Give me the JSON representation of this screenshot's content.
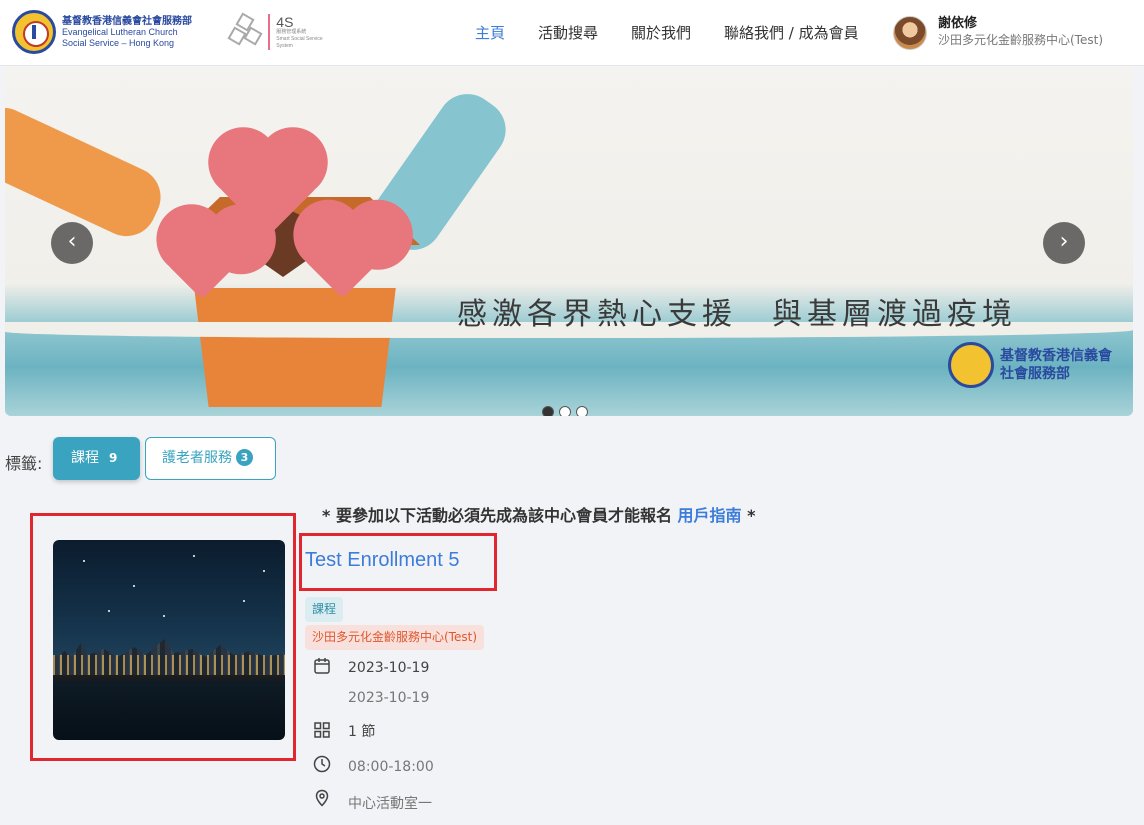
{
  "header": {
    "logo_org": {
      "zh": "基督教香港信義會社會服務部",
      "en1": "Evangelical Lutheran Church",
      "en2": "Social Service – Hong Kong"
    },
    "logo_4s": {
      "title": "4S",
      "sub1": "服務管理系統",
      "sub2": "Smart Social Service System"
    },
    "nav": [
      "主頁",
      "活動搜尋",
      "關於我們",
      "聯絡我們 / 成為會員"
    ],
    "active_nav": "主頁",
    "user": {
      "name": "謝依修",
      "center": "沙田多元化金齡服務中心(Test)"
    }
  },
  "banner": {
    "text": "感激各界熱心支援　與基層渡過疫境",
    "logo_line1": "基督教香港信義會",
    "logo_line2": "社會服務部",
    "prev_icon": "‹",
    "next_icon": "›",
    "slides": 3,
    "current_slide": 1
  },
  "tags": {
    "label": "標籤:",
    "items": [
      {
        "name": "課程",
        "count": "9",
        "active": true
      },
      {
        "name": "護老者服務",
        "count": "3",
        "active": false
      }
    ]
  },
  "notice": {
    "prefix": "* 要參加以下活動必須先成為該中心會員才能報名",
    "link": "用戶指南",
    "suffix": "*"
  },
  "activity": {
    "title": "Test Enrollment 5",
    "category": "課程",
    "center": "沙田多元化金齡服務中心(Test)",
    "start_date": "2023-10-19",
    "end_date": "2023-10-19",
    "sessions": "1 節",
    "time": "08:00-18:00",
    "venue": "中心活動室一"
  },
  "colors": {
    "accent": "#3aa4c0",
    "link": "#3c7dd9",
    "highlight": "#e0262e",
    "center_tag": "#e2562f"
  }
}
